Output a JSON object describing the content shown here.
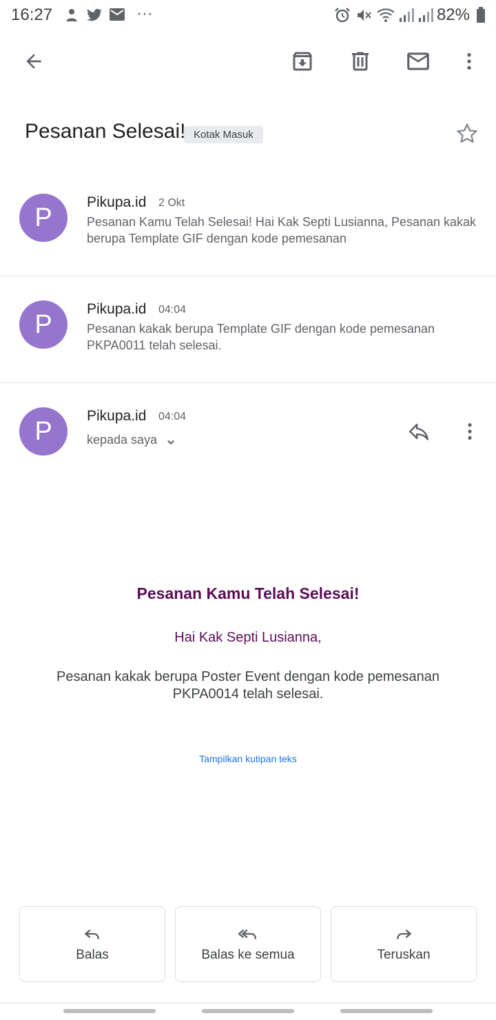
{
  "status_bar": {
    "time": "16:27",
    "battery": "82%",
    "more": "···"
  },
  "subject": "Pesanan Selesai!",
  "label": "Kotak Masuk",
  "messages": [
    {
      "avatar": "P",
      "sender": "Pikupa.id",
      "date": "2 Okt",
      "snippet": "Pesanan Kamu Telah Selesai! Hai Kak Septi Lusianna, Pesanan kakak berupa Template GIF dengan kode pemesanan"
    },
    {
      "avatar": "P",
      "sender": "Pikupa.id",
      "date": "04:04",
      "snippet": "Pesanan kakak berupa Template GIF dengan kode pemesanan PKPA0011 telah selesai."
    },
    {
      "avatar": "P",
      "sender": "Pikupa.id",
      "date": "04:04",
      "recipient": "kepada saya"
    }
  ],
  "body": {
    "title": "Pesanan Kamu Telah Selesai!",
    "greeting": "Hai Kak Septi Lusianna,",
    "text": "Pesanan kakak berupa Poster Event dengan kode pemesanan PKPA0014 telah selesai.",
    "show_quoted": "Tampilkan kutipan teks"
  },
  "actions": {
    "reply": "Balas",
    "reply_all": "Balas ke semua",
    "forward": "Teruskan"
  },
  "icons": [
    "back-arrow-icon",
    "archive-icon",
    "delete-icon",
    "mail-icon",
    "more-vert-icon",
    "star-icon",
    "reply-icon",
    "reply-all-icon",
    "forward-icon",
    "chevron-down-icon"
  ],
  "colors": {
    "avatar": "#9575cd",
    "body_title": "#5b0c56",
    "link": "#1a73e8"
  }
}
